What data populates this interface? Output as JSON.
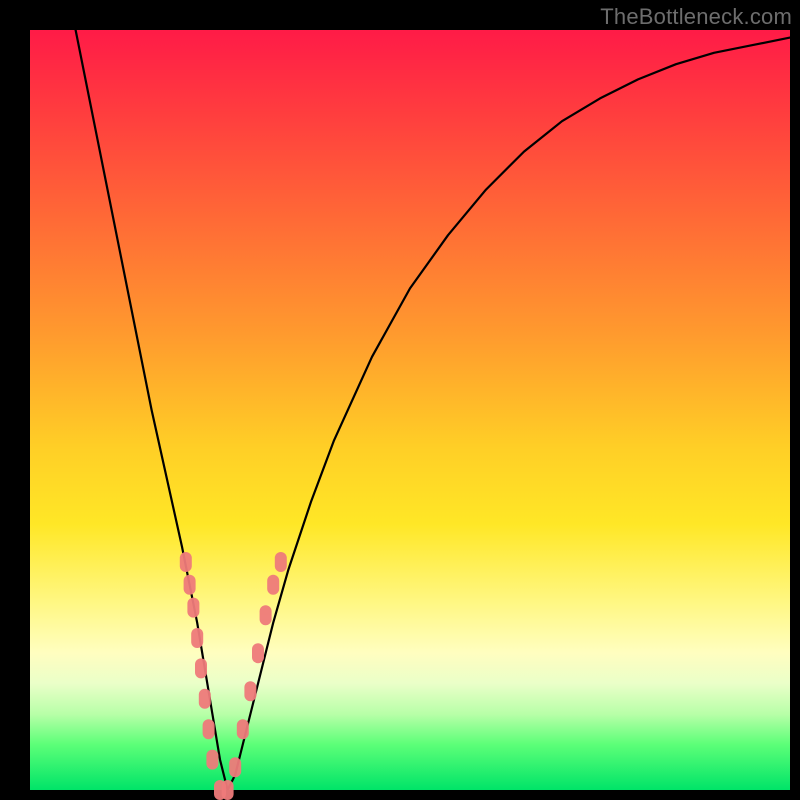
{
  "watermark": "TheBottleneck.com",
  "chart_data": {
    "type": "line",
    "title": "",
    "xlabel": "",
    "ylabel": "",
    "xlim": [
      0,
      100
    ],
    "ylim": [
      0,
      100
    ],
    "grid": false,
    "series": [
      {
        "name": "curve",
        "color": "#000000",
        "x": [
          6,
          8,
          10,
          12,
          14,
          16,
          18,
          20,
          22,
          23,
          24,
          25,
          26,
          27,
          28,
          30,
          32,
          34,
          37,
          40,
          45,
          50,
          55,
          60,
          65,
          70,
          75,
          80,
          85,
          90,
          95,
          100
        ],
        "y": [
          100,
          90,
          80,
          70,
          60,
          50,
          41,
          32,
          22,
          16,
          10,
          4,
          0,
          2,
          6,
          14,
          22,
          29,
          38,
          46,
          57,
          66,
          73,
          79,
          84,
          88,
          91,
          93.5,
          95.5,
          97,
          98,
          99
        ]
      },
      {
        "name": "markers",
        "color": "#ee7a7a",
        "x": [
          20.5,
          21,
          21.5,
          22,
          22.5,
          23,
          23.5,
          24,
          25,
          26,
          27,
          28,
          29,
          30,
          31,
          32,
          33
        ],
        "y": [
          30,
          27,
          24,
          20,
          16,
          12,
          8,
          4,
          0,
          0,
          3,
          8,
          13,
          18,
          23,
          27,
          30
        ]
      }
    ],
    "annotations": []
  }
}
